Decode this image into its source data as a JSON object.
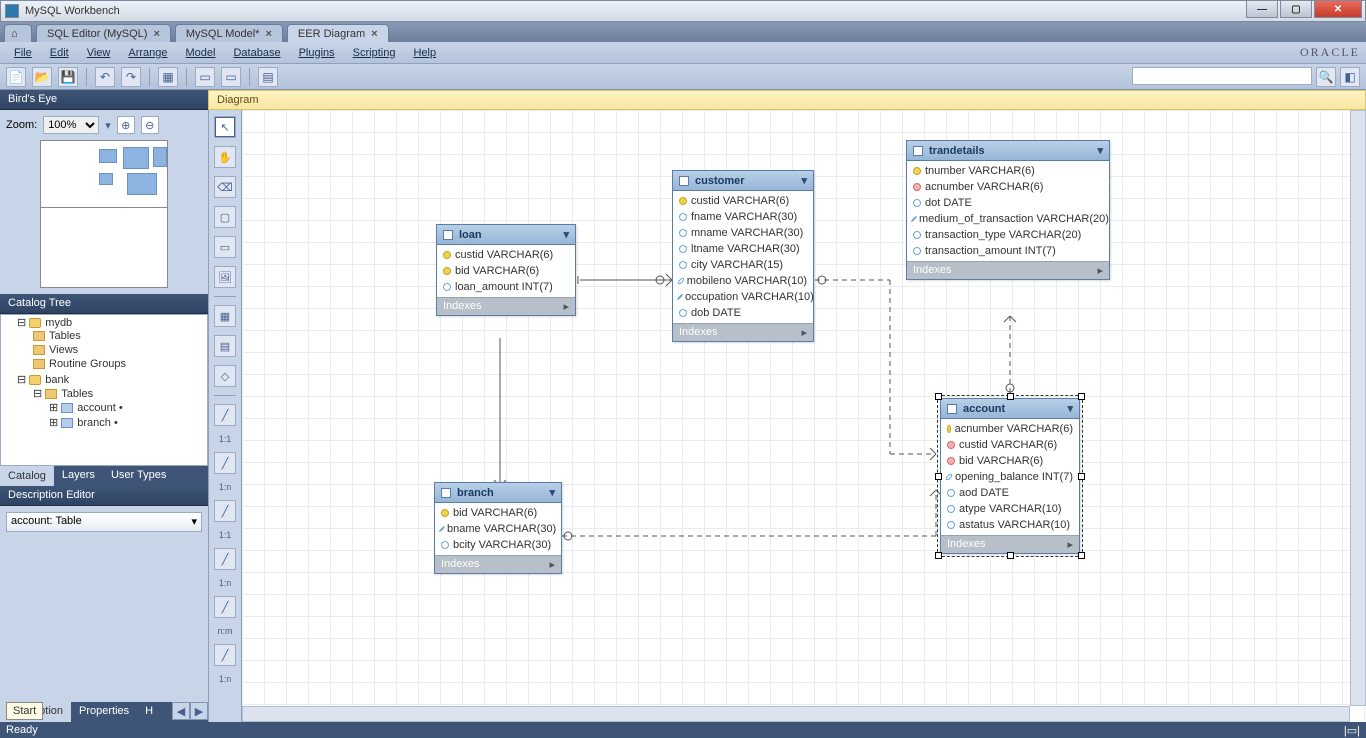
{
  "app": {
    "title": "MySQL Workbench",
    "oracle": "ORACLE"
  },
  "winbtns": {
    "min": "—",
    "max": "▢",
    "close": "✕"
  },
  "apptabs": {
    "home": "⌂",
    "items": [
      {
        "label": "SQL Editor (MySQL)",
        "closable": true
      },
      {
        "label": "MySQL Model*",
        "closable": true
      },
      {
        "label": "EER Diagram",
        "closable": true,
        "active": true
      }
    ]
  },
  "menu": [
    "File",
    "Edit",
    "View",
    "Arrange",
    "Model",
    "Database",
    "Plugins",
    "Scripting",
    "Help"
  ],
  "toolbar_icons": [
    "new",
    "open",
    "save",
    "sep",
    "undo",
    "redo",
    "sep",
    "grid",
    "sep",
    "snap",
    "snap2",
    "sep",
    "export"
  ],
  "search": {
    "placeholder": ""
  },
  "birdseye": {
    "title": "Bird's Eye",
    "zoom_label": "Zoom:",
    "zoom_value": "100%"
  },
  "catalog": {
    "title": "Catalog Tree",
    "db1": "mydb",
    "db1_children": [
      "Tables",
      "Views",
      "Routine Groups"
    ],
    "db2": "bank",
    "db2_children_label": "Tables",
    "db2_tables": [
      "account •",
      "branch •"
    ]
  },
  "sidetabs": [
    "Catalog",
    "Layers",
    "User Types"
  ],
  "descedit": {
    "title": "Description Editor",
    "value": "account: Table"
  },
  "bottomtabs": [
    "Description",
    "Properties",
    "H"
  ],
  "canvas": {
    "title": "Diagram"
  },
  "vtool": {
    "buttons": [
      "pointer",
      "hand",
      "eraser",
      "layer",
      "note",
      "image",
      "sep",
      "table",
      "view",
      "routine",
      "sep"
    ],
    "rels": [
      "1:1",
      "1:n",
      "1:1",
      "1:n",
      "n:m",
      "1:n"
    ]
  },
  "entities": {
    "loan": {
      "title": "loan",
      "cols": [
        {
          "k": "pk",
          "name": "custid VARCHAR(6)"
        },
        {
          "k": "pk",
          "name": "bid VARCHAR(6)"
        },
        {
          "k": "col",
          "name": "loan_amount INT(7)"
        }
      ],
      "idx": "Indexes"
    },
    "customer": {
      "title": "customer",
      "cols": [
        {
          "k": "pk",
          "name": "custid VARCHAR(6)"
        },
        {
          "k": "col",
          "name": "fname VARCHAR(30)"
        },
        {
          "k": "col",
          "name": "mname VARCHAR(30)"
        },
        {
          "k": "col",
          "name": "ltname VARCHAR(30)"
        },
        {
          "k": "col",
          "name": "city VARCHAR(15)"
        },
        {
          "k": "col",
          "name": "mobileno VARCHAR(10)"
        },
        {
          "k": "col",
          "name": "occupation VARCHAR(10)"
        },
        {
          "k": "col",
          "name": "dob DATE"
        }
      ],
      "idx": "Indexes"
    },
    "branch": {
      "title": "branch",
      "cols": [
        {
          "k": "pk",
          "name": "bid VARCHAR(6)"
        },
        {
          "k": "col",
          "name": "bname VARCHAR(30)"
        },
        {
          "k": "col",
          "name": "bcity VARCHAR(30)"
        }
      ],
      "idx": "Indexes"
    },
    "trandetails": {
      "title": "trandetails",
      "cols": [
        {
          "k": "pk",
          "name": "tnumber VARCHAR(6)"
        },
        {
          "k": "fk",
          "name": "acnumber VARCHAR(6)"
        },
        {
          "k": "col",
          "name": "dot DATE"
        },
        {
          "k": "col",
          "name": "medium_of_transaction VARCHAR(20)"
        },
        {
          "k": "col",
          "name": "transaction_type VARCHAR(20)"
        },
        {
          "k": "col",
          "name": "transaction_amount INT(7)"
        }
      ],
      "idx": "Indexes"
    },
    "account": {
      "title": "account",
      "cols": [
        {
          "k": "pk",
          "name": "acnumber VARCHAR(6)"
        },
        {
          "k": "fk",
          "name": "custid VARCHAR(6)"
        },
        {
          "k": "fk",
          "name": "bid VARCHAR(6)"
        },
        {
          "k": "col",
          "name": "opening_balance INT(7)"
        },
        {
          "k": "col",
          "name": "aod DATE"
        },
        {
          "k": "col",
          "name": "atype VARCHAR(10)"
        },
        {
          "k": "col",
          "name": "astatus VARCHAR(10)"
        }
      ],
      "idx": "Indexes"
    }
  },
  "status": {
    "left": "Ready",
    "start": "Start"
  }
}
